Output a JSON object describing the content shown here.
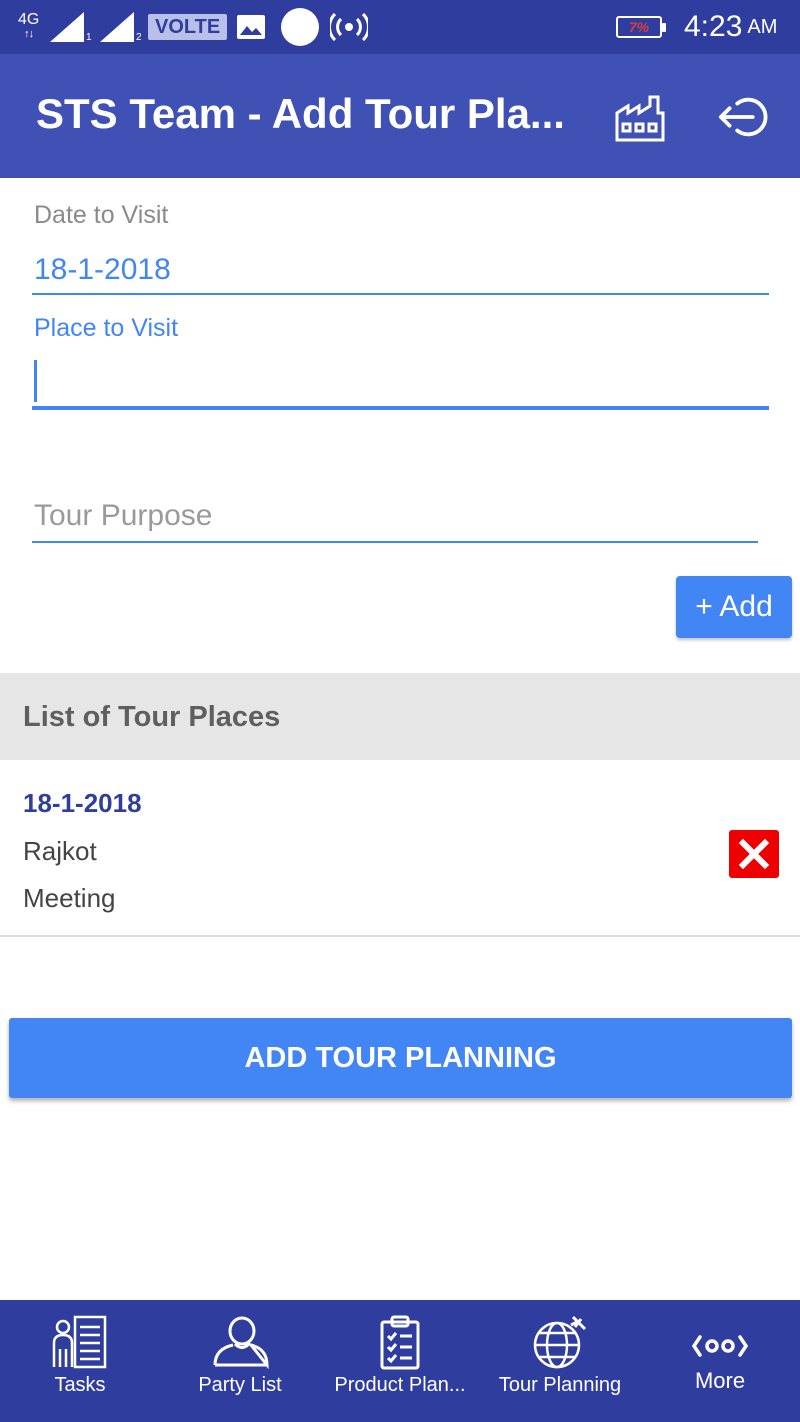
{
  "status_bar": {
    "network": "4G",
    "network_arrows": "↑↓",
    "sim1": "1",
    "sim2": "2",
    "volte": "VOLTE",
    "battery": "7%",
    "time": "4:23",
    "ampm": "AM"
  },
  "app_bar": {
    "title": "STS Team - Add Tour Pla..."
  },
  "form": {
    "date_label": "Date to Visit",
    "date_value": "18-1-2018",
    "place_label": "Place to Visit",
    "place_value": "",
    "purpose_placeholder": "Tour Purpose",
    "add_label": "+ Add"
  },
  "list": {
    "header": "List of Tour Places",
    "items": [
      {
        "date": "18-1-2018",
        "place": "Rajkot",
        "purpose": "Meeting"
      }
    ]
  },
  "submit_label": "ADD TOUR PLANNING",
  "bottom_nav": {
    "items": [
      {
        "label": "Tasks",
        "icon": "tasks-icon"
      },
      {
        "label": "Party List",
        "icon": "party-list-icon"
      },
      {
        "label": "Product Plan...",
        "icon": "product-plan-icon"
      },
      {
        "label": "Tour Planning",
        "icon": "tour-planning-icon"
      },
      {
        "label": "More",
        "icon": "more-icon"
      }
    ]
  },
  "colors": {
    "status_bar": "#2f3e9e",
    "app_bar": "#3f51b5",
    "accent": "#4285f4",
    "delete": "#ee0000",
    "list_header_bg": "#e6e6e6",
    "date_text": "#2f3e9e"
  }
}
